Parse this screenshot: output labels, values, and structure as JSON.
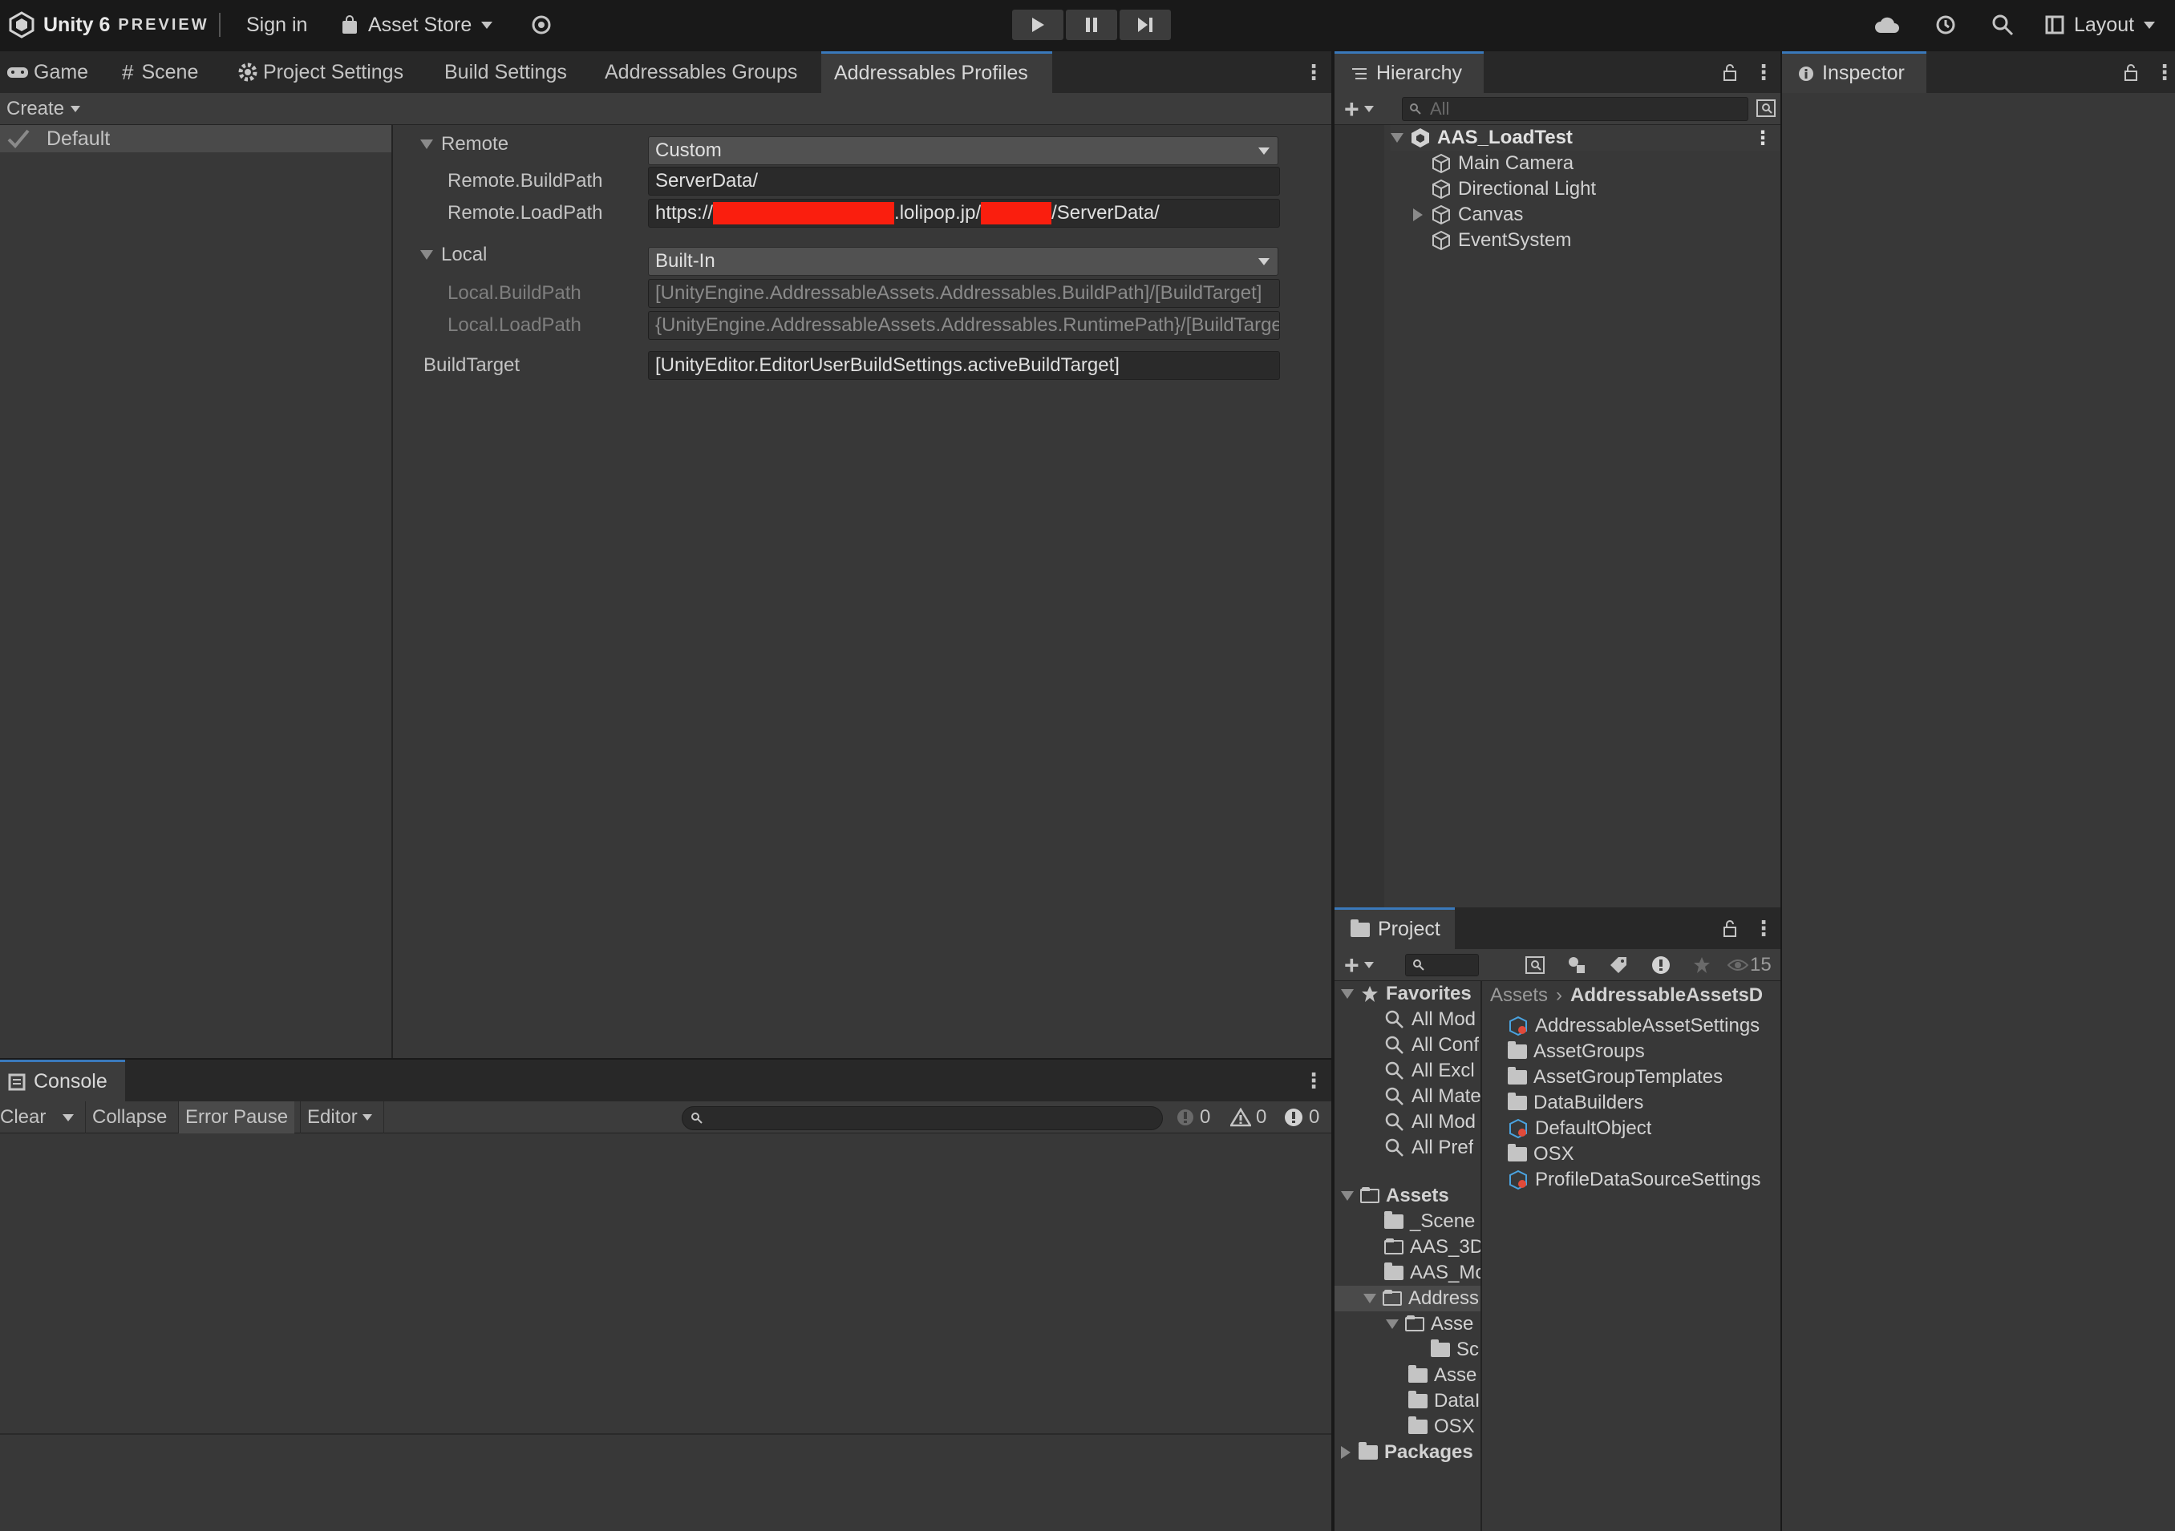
{
  "toolbar": {
    "product": "Unity 6",
    "edition": "PREVIEW",
    "sign_in": "Sign in",
    "asset_store": "Asset Store",
    "layout": "Layout"
  },
  "main_tabs": [
    "Game",
    "Scene",
    "Project Settings",
    "Build Settings",
    "Addressables Groups",
    "Addressables Profiles"
  ],
  "profiles": {
    "create_label": "Create",
    "profile_list": [
      {
        "name": "Default",
        "checked": true
      }
    ],
    "remote": {
      "label": "Remote",
      "dropdown": "Custom",
      "build_path_label": "Remote.BuildPath",
      "build_path_value": "ServerData/",
      "load_path_label": "Remote.LoadPath",
      "load_path_prefix": "https://",
      "load_path_middle": ".lolipop.jp/",
      "load_path_suffix": "/ServerData/"
    },
    "local": {
      "label": "Local",
      "dropdown": "Built-In",
      "build_path_label": "Local.BuildPath",
      "build_path_value": "[UnityEngine.AddressableAssets.Addressables.BuildPath]/[BuildTarget]",
      "load_path_label": "Local.LoadPath",
      "load_path_value": "{UnityEngine.AddressableAssets.Addressables.RuntimePath}/[BuildTarget]"
    },
    "build_target": {
      "label": "BuildTarget",
      "value": "[UnityEditor.EditorUserBuildSettings.activeBuildTarget]"
    }
  },
  "hierarchy": {
    "tab": "Hierarchy",
    "search_placeholder": "All",
    "scene": "AAS_LoadTest",
    "items": [
      "Main Camera",
      "Directional Light",
      "Canvas",
      "EventSystem"
    ]
  },
  "inspector": {
    "tab": "Inspector"
  },
  "project": {
    "tab": "Project",
    "hidden_count": "15",
    "favorites_label": "Favorites",
    "favorites": [
      "All Mod",
      "All Conf",
      "All Excl",
      "All Mate",
      "All Mod",
      "All Pref"
    ],
    "assets_label": "Assets",
    "asset_tree": [
      {
        "name": "_Scene",
        "depth": 1,
        "open": false
      },
      {
        "name": "AAS_3D",
        "depth": 1,
        "open": false,
        "empty": true
      },
      {
        "name": "AAS_Mo",
        "depth": 1,
        "open": false
      },
      {
        "name": "Address",
        "depth": 1,
        "open": true,
        "selected": true
      },
      {
        "name": "Asse",
        "depth": 2,
        "open": true
      },
      {
        "name": "Sc",
        "depth": 3,
        "open": false
      },
      {
        "name": "Asse",
        "depth": 2,
        "open": false
      },
      {
        "name": "DataI",
        "depth": 2,
        "open": false
      },
      {
        "name": "OSX",
        "depth": 2,
        "open": false
      }
    ],
    "packages_label": "Packages",
    "breadcrumb_root": "Assets",
    "breadcrumb_current": "AddressableAssetsD",
    "contents": [
      {
        "name": "AddressableAssetSettings",
        "type": "asset"
      },
      {
        "name": "AssetGroups",
        "type": "folder"
      },
      {
        "name": "AssetGroupTemplates",
        "type": "folder"
      },
      {
        "name": "DataBuilders",
        "type": "folder"
      },
      {
        "name": "DefaultObject",
        "type": "asset"
      },
      {
        "name": "OSX",
        "type": "folder"
      },
      {
        "name": "ProfileDataSourceSettings",
        "type": "asset"
      }
    ]
  },
  "console": {
    "tab": "Console",
    "clear": "Clear",
    "collapse": "Collapse",
    "error_pause": "Error Pause",
    "editor": "Editor",
    "log_count": "0",
    "warn_count": "0",
    "error_count": "0"
  }
}
